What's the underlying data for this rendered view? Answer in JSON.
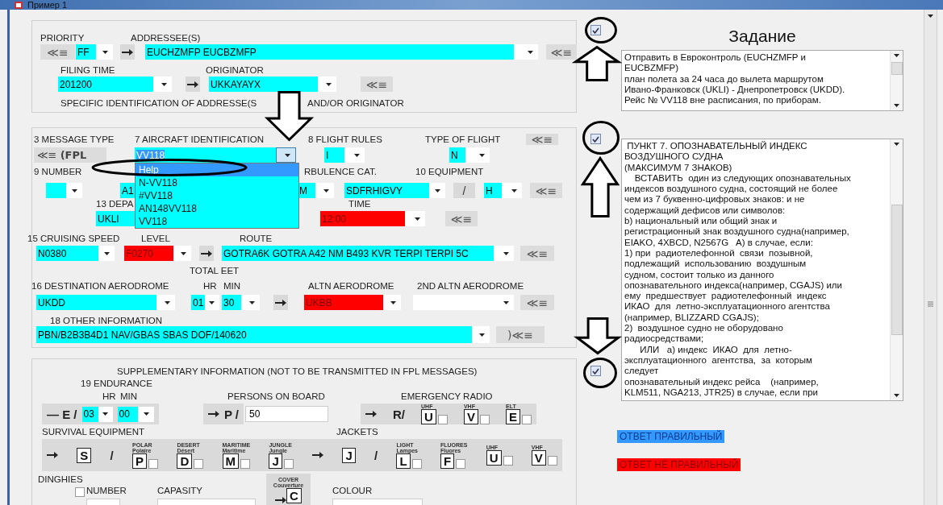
{
  "window": {
    "title": "Пример 1"
  },
  "addressing": {
    "checked": true,
    "priority_label": "PRIORITY",
    "addressees_label": "ADDRESSEE(S)",
    "priority_button": "≪≡",
    "priority": {
      "value": "FF",
      "color": "#00ffff"
    },
    "addressees": {
      "value": "EUCHZMFP EUCBZMFP",
      "color": "#00ffff"
    },
    "addressees_button": "≪≡",
    "filing_time_label": "FILING TIME",
    "originator_label": "ORIGINATOR",
    "filing_time": {
      "value": "201200",
      "color": "#00ffff"
    },
    "originator": {
      "value": "UKKAYAYX",
      "color": "#00ffff"
    },
    "originator_button": "≪≡",
    "note": "SPECIFIC IDENTIFICATION OF ADDRESSE(S",
    "note_2": "AND/OR ORIGINATOR"
  },
  "flight_plan": {
    "checked": true,
    "message_type_label": "3 MESSAGE TYPE",
    "aircraft_id_label": "7 AIRCRAFT IDENTIFICATION",
    "flight_rules_label": "8 FLIGHT RULES",
    "flight_type_label": "TYPE OF FLIGHT",
    "type_button": "≪≡",
    "message_type_button": "≪≡ **(FPL**",
    "aircraft_id": {
      "value": "VV118",
      "color": "#00ffff",
      "highlighted": true,
      "open": true
    },
    "aircraft_id_options": [
      {
        "text": "Help",
        "selected": true
      },
      {
        "text": "N-VV118",
        "selected": false
      },
      {
        "text": "#VV118",
        "selected": false
      },
      {
        "text": "AN148VV118",
        "selected": false
      },
      {
        "text": "VV118",
        "selected": false
      }
    ],
    "flight_rules": {
      "value": "I",
      "color": "#00ffff"
    },
    "flight_type": {
      "value": "N",
      "color": "#00ffff"
    },
    "number_label": "9 NUMBER",
    "wake_label": "RBULENCE CAT.",
    "equipment_label": "10 EQUIPMENT",
    "number": {
      "color": "#00ffff"
    },
    "aircraft_type": {
      "value": "A1",
      "color": "#00ffff"
    },
    "wake": {
      "value": "M",
      "color": "#00ffff"
    },
    "equipment": {
      "value": "SDFRHIGVY",
      "color": "#00ffff"
    },
    "equipment_separator": "/",
    "surveillance": {
      "value": "H",
      "color": "#00ffff"
    },
    "equipment_button": "≪≡",
    "departure_label": "13 DEPA",
    "time_label": "TIME",
    "departure": {
      "value": "UKLI",
      "color": "#00ffff"
    },
    "time": {
      "value": "12:00",
      "color": "#ff0000"
    },
    "departure_button": "≪≡",
    "speed_label": "15 CRUISING SPEED",
    "flight_level_label": "LEVEL",
    "route_label": "ROUTE",
    "speed": {
      "value": "N0380",
      "color": "#00ffff"
    },
    "flight_level": {
      "value": "F0270",
      "color": "#ff0000"
    },
    "route": {
      "value": "GOTRA6K GOTRA A42 NM B493 KVR TERPI TERPI 5C",
      "color": "#00ffff"
    },
    "route_button": "≪≡",
    "total_eet_label": "TOTAL EET",
    "destination_label": "16 DESTINATION AERODROME",
    "hr_label": "HR",
    "min_label": "MIN",
    "altn_label": "ALTN AERODROME",
    "altn2_label": "2ND ALTN AERODROME",
    "destination": {
      "value": "UKDD",
      "color": "#00ffff"
    },
    "eet_hr": {
      "value": "01",
      "color": "#00ffff"
    },
    "eet_min": {
      "value": "30",
      "color": "#00ffff"
    },
    "altn": {
      "value": "UKBB",
      "color": "#ff0000"
    },
    "altn2": {
      "color": "#ffffff"
    },
    "destination_button": "≪≡",
    "other_label": "18 OTHER INFORMATION",
    "other": {
      "value": "PBN/B2B3B4D1 NAV/GBAS SBAS DOF/140620",
      "color": "#00ffff"
    },
    "other_button": ")≪≡"
  },
  "supplementary": {
    "checked": true,
    "title": "SUPPLEMENTARY INFORMATION (NOT TO BE TRANSMITTED IN FPL MESSAGES)",
    "endurance_label": "19 ENDURANCE",
    "hr_label": "HR",
    "min_label": "MIN",
    "persons_label": "PERSONS ON BOARD",
    "radio_label": "EMERGENCY RADIO",
    "endurance_prefix": "— E /",
    "endurance_hr": {
      "value": "03",
      "color": "#00ffff"
    },
    "endurance_min": {
      "value": "00",
      "color": "#00ffff"
    },
    "persons_prefix": "P /",
    "persons": "50",
    "radio_prefix": "R/",
    "radios": [
      {
        "caption": "UHF",
        "letter": "U",
        "checked": false
      },
      {
        "caption": "VHF",
        "letter": "V",
        "checked": false
      },
      {
        "caption": "ELT",
        "letter": "E",
        "checked": false
      }
    ],
    "survival_label": "SURVIVAL EQUIPMENT",
    "jackets_label": "JACKETS",
    "survival_prefix": "S",
    "survival_separator": "/",
    "survival": [
      {
        "caption": "POLAR",
        "caption_2": "Polaire",
        "letter": "P",
        "checked": false
      },
      {
        "caption": "DESERT",
        "caption_2": "Désert",
        "letter": "D",
        "checked": false
      },
      {
        "caption": "MARITIME",
        "caption_2": "Maritime",
        "letter": "M",
        "checked": false
      },
      {
        "caption": "JUNGLE",
        "caption_2": "Jungle",
        "letter": "J",
        "checked": false
      }
    ],
    "jackets_prefix": "J",
    "jackets_separator": "/",
    "jackets": [
      {
        "caption": "LIGHT",
        "caption_2": "Lampes",
        "letter": "L",
        "checked": false
      },
      {
        "caption": "FLUORES",
        "caption_2": "Fluores",
        "letter": "F",
        "checked": false
      },
      {
        "caption": "UHF",
        "letter": "U",
        "checked": false
      },
      {
        "caption": "VHF",
        "letter": "V",
        "checked": false
      }
    ],
    "dinghies_label": "DINGHIES",
    "dinghies_checked": false,
    "number_label": "NUMBER",
    "capacity_label": "CAPASITY",
    "cover_caption": "COVER",
    "cover_caption_2": "Couverture",
    "cover_letter": "C",
    "colour_label": "COLOUR"
  },
  "task": {
    "heading": "Задание",
    "summary_lines": [
      "Отправить в Евроконтроль (EUCHZMFP и",
      "EUCBZMFP)",
      "план полета за 24 часа до вылета маршрутом",
      "Ивано-Франковск (UKLI) - Днепропетровск (UKDD).",
      "Рейс № VV118 вне расписания, по приборам."
    ],
    "help_lines": [
      " ПУНКТ 7. ОПОЗНАВАТЕЛЬНЫЙ ИНДЕКС",
      "ВОЗДУШНОГО СУДНА",
      "(МАКСИМУМ 7 ЗНАКОВ)",
      "    ВСТАВИТЬ  один из следующих опознавательных",
      "индексов воздушного судна, состоящий не более",
      "чем из 7 буквенно-цифровых знаков: и не",
      "содержащий дефисов или символов:",
      "b) национальный или общий знак и",
      "регистрационный знак воздушного судна(например,",
      "EIAKO, 4XBCD, N2567G   A) в случае, если:",
      "1) при  радиотелефонной  связи  позывной,",
      "подлежащий  использованию  воздушным",
      "судном, состоит только из данного",
      "опознавательного индекса(например, CGAJS) или",
      "ему  предшествует  радиотелефонный  индекс",
      "ИКАО  для  летно-эксплуатационного агентства",
      "(например, BLIZZARD CGAJS);",
      "2)  воздушное судно не оборудовано",
      "радиосредствами;",
      "      ИЛИ   а) индекс  ИКАО  для  летно-",
      "эксплуатационного  агентства,  за  которым",
      "следует",
      "опознавательный индекс рейса    (например,",
      "KLM511, NGA213, JTR25) в случае, если при"
    ],
    "results": [
      {
        "text": "ОТВЕТ ПРАВИЛЬНЫЙ",
        "kind": "correct",
        "color": "#3399ff"
      },
      {
        "text": "ОТВЕТ НЕ ПРАВИЛЬНЫЙ",
        "kind": "incorrect",
        "color": "#ff0000"
      }
    ]
  }
}
